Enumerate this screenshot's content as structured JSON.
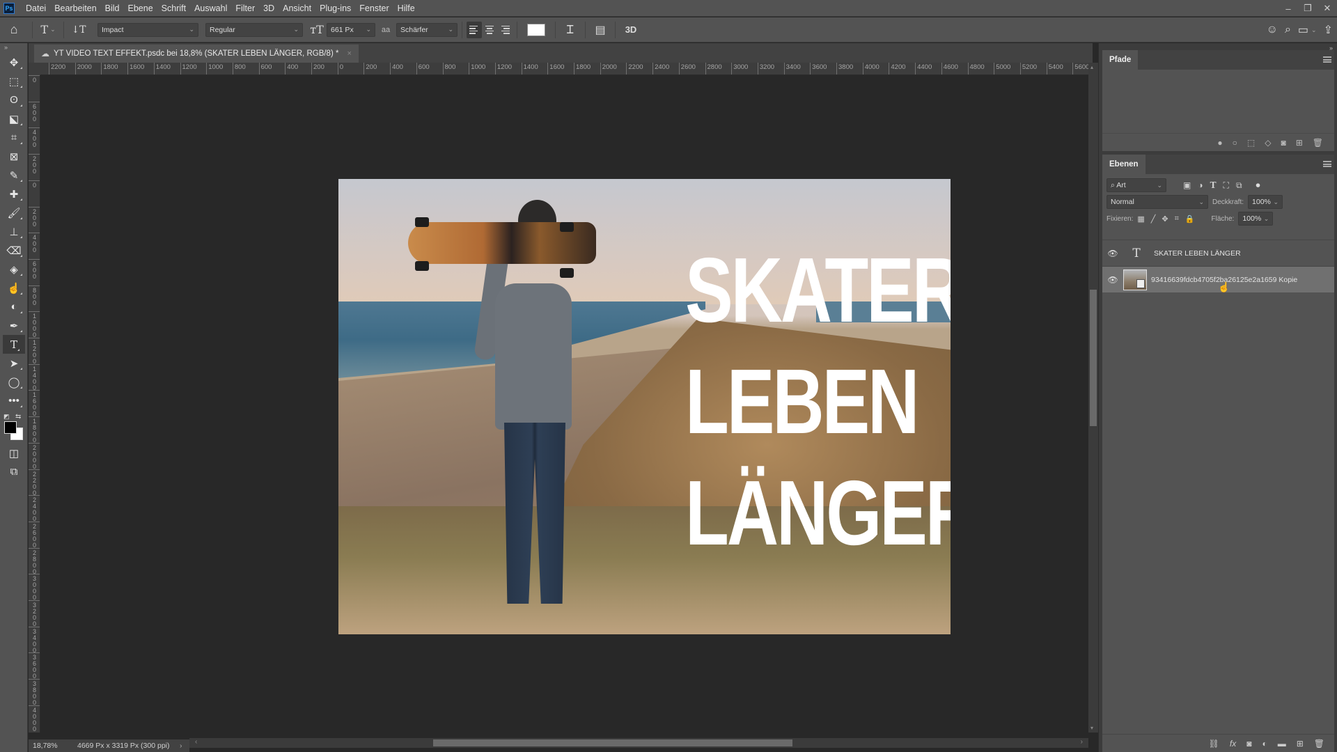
{
  "app": {
    "logo": "Ps",
    "name": "Photoshop"
  },
  "menu": [
    "Datei",
    "Bearbeiten",
    "Bild",
    "Ebene",
    "Schrift",
    "Auswahl",
    "Filter",
    "3D",
    "Ansicht",
    "Plug-ins",
    "Fenster",
    "Hilfe"
  ],
  "window_controls": {
    "minimize": "–",
    "restore": "❐",
    "close": "✕"
  },
  "options_bar": {
    "font_family": "Impact",
    "font_style": "Regular",
    "font_size": "661 Px",
    "antialias_icon": "aa",
    "antialias": "Schärfer",
    "alignment_selected": "left",
    "text_color": "#ffffff",
    "label_3d": "3D"
  },
  "document": {
    "tab_title": "YT VIDEO TEXT EFFEKT.psdc bei 18,8% (SKATER LEBEN LÄNGER, RGB/8) *",
    "close_glyph": "×",
    "headline_lines": [
      "SKATER",
      "LEBEN",
      "LÄNGER"
    ]
  },
  "rulers": {
    "horizontal": [
      "2200",
      "2000",
      "1800",
      "1600",
      "1400",
      "1200",
      "1000",
      "800",
      "600",
      "400",
      "200",
      "0",
      "200",
      "400",
      "600",
      "800",
      "1000",
      "1200",
      "1400",
      "1600",
      "1800",
      "2000",
      "2200",
      "2400",
      "2600",
      "2800",
      "3000",
      "3200",
      "3400",
      "3600",
      "3800",
      "4000",
      "4200",
      "4400",
      "4600",
      "4800",
      "5000",
      "5200",
      "5400",
      "5600"
    ],
    "vertical": [
      "0",
      "600",
      "400",
      "200",
      "0",
      "200",
      "400",
      "600",
      "800",
      "1000",
      "1200",
      "1400",
      "1600",
      "1800",
      "2000",
      "2200",
      "2400",
      "2600",
      "2800",
      "3000",
      "3200",
      "3400",
      "3600",
      "3800",
      "4000"
    ]
  },
  "status": {
    "zoom": "18,78%",
    "doc_size": "4669 Px x 3319 Px (300 ppi)",
    "chevron": "›"
  },
  "panels": {
    "paths": {
      "title": "Pfade"
    },
    "layers": {
      "title": "Ebenen",
      "filter_kind": "Art",
      "blend_mode": "Normal",
      "opacity_label": "Deckkraft:",
      "opacity": "100%",
      "lock_label": "Fixieren:",
      "fill_label": "Fläche:",
      "fill": "100%",
      "items": [
        {
          "name": "SKATER LEBEN LÄNGER",
          "type": "text",
          "visible": true,
          "selected": false
        },
        {
          "name": "93416639fdcb4705f2ba26125e2a1659  Kopie",
          "type": "smart-object",
          "visible": true,
          "selected": true
        }
      ]
    }
  }
}
